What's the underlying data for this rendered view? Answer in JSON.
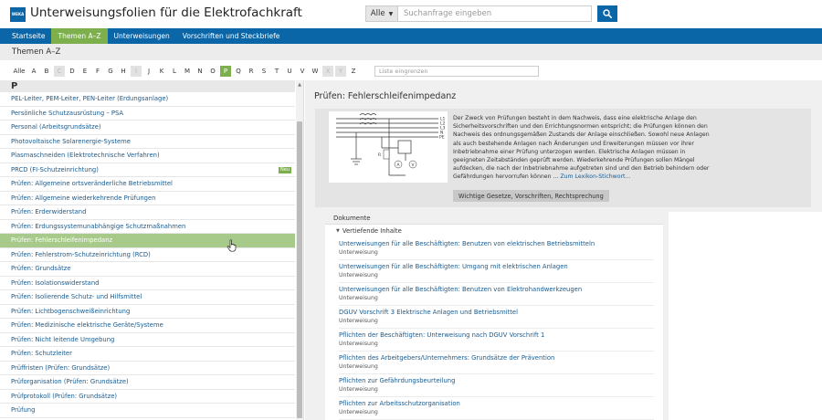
{
  "app": {
    "logo_text": "WEKA",
    "title": "Unterweisungsfolien für die Elektrofachkraft"
  },
  "search": {
    "scope": "Alle",
    "placeholder": "Suchanfrage eingeben"
  },
  "nav": {
    "items": [
      {
        "label": "Startseite",
        "active": false
      },
      {
        "label": "Themen A–Z",
        "active": true
      },
      {
        "label": "Unterweisungen",
        "active": false
      },
      {
        "label": "Vorschriften und Steckbriefe",
        "active": false
      }
    ]
  },
  "section_title": "Themen A–Z",
  "alphabet": {
    "all_label": "Alle",
    "letters": [
      "A",
      "B",
      "C",
      "D",
      "E",
      "F",
      "G",
      "H",
      "I",
      "J",
      "K",
      "L",
      "M",
      "N",
      "O",
      "P",
      "Q",
      "R",
      "S",
      "T",
      "U",
      "V",
      "W",
      "X",
      "Y",
      "Z"
    ],
    "disabled": [
      "C",
      "I",
      "X",
      "Y"
    ],
    "active": "P",
    "filter_placeholder": "Liste eingrenzen"
  },
  "list": {
    "group_letter": "P",
    "items": [
      {
        "label": "PEL-Leiter, PEM-Leiter, PEN-Leiter (Erdungsanlage)"
      },
      {
        "label": "Persönliche Schutzausrüstung – PSA"
      },
      {
        "label": "Personal (Arbeitsgrundsätze)"
      },
      {
        "label": "Photovoltaische Solarenergie-Systeme"
      },
      {
        "label": "Plasmaschneiden (Elektrotechnische Verfahren)"
      },
      {
        "label": "PRCD (FI-Schutzeinrichtung)",
        "badge": "Neu"
      },
      {
        "label": "Prüfen: Allgemeine ortsveränderliche Betriebsmittel"
      },
      {
        "label": "Prüfen: Allgemeine wiederkehrende Prüfungen"
      },
      {
        "label": "Prüfen: Erderwiderstand"
      },
      {
        "label": "Prüfen: Erdungssystemunabhängige Schutzmaßnahmen"
      },
      {
        "label": "Prüfen: Fehlerschleifenimpedanz",
        "selected": true
      },
      {
        "label": "Prüfen: Fehlerstrom-Schutzeinrichtung (RCD)"
      },
      {
        "label": "Prüfen: Grundsätze"
      },
      {
        "label": "Prüfen: Isolationswiderstand"
      },
      {
        "label": "Prüfen: Isolierende Schutz- und Hilfsmittel"
      },
      {
        "label": "Prüfen: Lichtbogenschweißeinrichtung"
      },
      {
        "label": "Prüfen: Medizinische elektrische Geräte/Systeme"
      },
      {
        "label": "Prüfen: Nicht leitende Umgebung"
      },
      {
        "label": "Prüfen: Schutzleiter"
      },
      {
        "label": "Prüffristen (Prüfen: Grundsätze)"
      },
      {
        "label": "Prüforganisation (Prüfen: Grundsätze)"
      },
      {
        "label": "Prüfprotokoll (Prüfen: Grundsätze)"
      },
      {
        "label": "Prüfung"
      }
    ]
  },
  "detail": {
    "title": "Prüfen: Fehlerschleifenimpedanz",
    "summary_lines": [
      "Der Zweck von Prüfungen besteht in dem Nachweis, dass eine elektrische Anlage den",
      "Sicherheitsvorschriften und den Errichtungsnormen entspricht; die Prüfungen können den",
      "Nachweis des ordnungsgemäßen Zustands der Anlage einschließen. Sowohl neue Anlagen",
      "als auch bestehende Anlagen nach Änderungen und Erweiterungen müssen vor ihrer",
      "Inbetriebnahme einer Prüfung unterzogen werden. Elektrische Anlagen müssen in",
      "geeigneten Zeitabständen geprüft werden. Wiederkehrende Prüfungen sollen Mängel",
      "aufdecken, die nach der Inbetriebnahme aufgetreten sind und den Betrieb behindern oder",
      "Gefährdungen hervorrufen können ..."
    ],
    "summary_link": "Zum Lexikon-Stichwort…",
    "rules_button": "Wichtige Gesetze, Vorschriften, Rechtsprechung",
    "diagram_labels": {
      "l1": "L1",
      "l2": "L2",
      "l3": "L3",
      "n": "N",
      "pe": "PE",
      "r": "R",
      "v": "V",
      "a": "A"
    }
  },
  "documents": {
    "header": "Dokumente",
    "group": "Vertiefende Inhalte",
    "items": [
      {
        "title": "Unterweisungen für alle Beschäftigten: Benutzen von elektrischen Betriebsmitteln",
        "type": "Unterweisung"
      },
      {
        "title": "Unterweisungen für alle Beschäftigten: Umgang mit elektrischen Anlagen",
        "type": "Unterweisung"
      },
      {
        "title": "Unterweisungen für alle Beschäftigten: Benutzen von Elektrohandwerkzeugen",
        "type": "Unterweisung"
      },
      {
        "title": "DGUV Vorschrift 3 Elektrische Anlagen und Betriebsmittel",
        "type": "Unterweisung"
      },
      {
        "title": "Pflichten der Beschäftigten: Unterweisung nach DGUV Vorschrift 1",
        "type": "Unterweisung"
      },
      {
        "title": "Pflichten des Arbeitgebers/Unternehmers: Grundsätze der Prävention",
        "type": "Unterweisung"
      },
      {
        "title": "Pflichten zur Gefährdungsbeurteilung",
        "type": "Unterweisung"
      },
      {
        "title": "Pflichten zur Arbeitsschutzorganisation",
        "type": "Unterweisung"
      }
    ]
  },
  "colors": {
    "brand_blue": "#0b66a8",
    "accent_green": "#7db04c",
    "selected_row": "#a7c98a",
    "link_blue": "#1a5a8e"
  }
}
